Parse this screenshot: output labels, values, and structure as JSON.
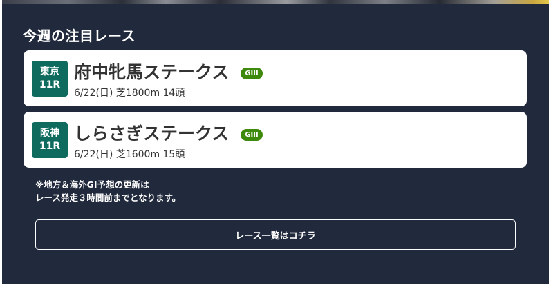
{
  "section": {
    "title": "今週の注目レース"
  },
  "races": [
    {
      "venue": "東京",
      "race_no": "11R",
      "name": "府中牝馬ステークス",
      "grade": "GIII",
      "info": "6/22(日) 芝1800m 14頭"
    },
    {
      "venue": "阪神",
      "race_no": "11R",
      "name": "しらさぎステークス",
      "grade": "GIII",
      "info": "6/22(日) 芝1600m 15頭"
    }
  ],
  "note": {
    "line1": "※地方＆海外GI予想の更新は",
    "line2": "レース発走３時間前までとなります。"
  },
  "button": {
    "label": "レース一覧はコチラ"
  },
  "colors": {
    "panel_bg": "#212a3c",
    "venue_badge": "#0f6b5e",
    "grade_badge": "#3e8a0d"
  }
}
